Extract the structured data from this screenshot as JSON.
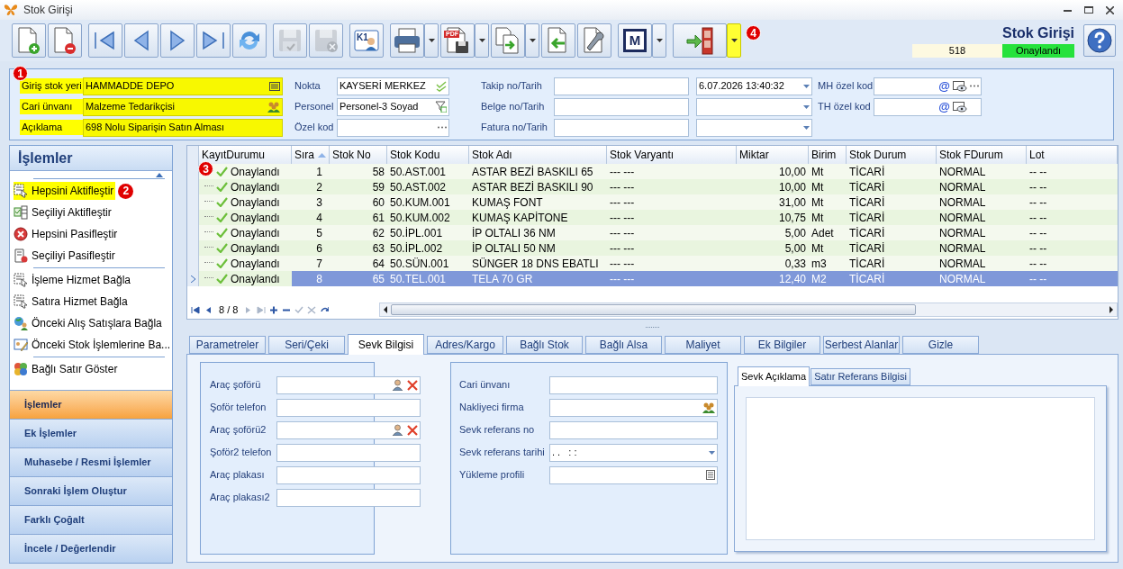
{
  "window": {
    "title": "Stok Girişi"
  },
  "toolbar": [
    {
      "kind": "button",
      "disabled": false
    },
    {
      "kind": "button",
      "disabled": false
    },
    {
      "kind": "button",
      "disabled": false
    },
    {
      "kind": "button",
      "disabled": false
    },
    {
      "kind": "button",
      "disabled": false
    },
    {
      "kind": "button",
      "disabled": false
    },
    {
      "kind": "button",
      "disabled": false
    },
    {
      "kind": "button",
      "disabled": true
    },
    {
      "kind": "button",
      "disabled": true
    },
    {
      "kind": "button",
      "disabled": false,
      "badge": "K1"
    },
    {
      "kind": "split",
      "disabled": false
    },
    {
      "kind": "split",
      "disabled": false,
      "badge": "PDF"
    },
    {
      "kind": "split",
      "disabled": false
    },
    {
      "kind": "button",
      "disabled": false
    },
    {
      "kind": "button",
      "disabled": false
    },
    {
      "kind": "split",
      "disabled": false,
      "badge": "M"
    },
    {
      "kind": "split",
      "disabled": false,
      "highlighted": true,
      "callout": "4"
    }
  ],
  "header": {
    "title": "Stok Girişi",
    "record_no": "518",
    "status": "Onaylandı"
  },
  "form": {
    "callout": "1",
    "main_fields": [
      {
        "label": "Giriş stok yeri",
        "value": "HAMMADDE DEPO",
        "highlighted": true
      },
      {
        "label": "Cari ünvanı",
        "value": "Malzeme Tedarikçisi",
        "highlighted": true
      },
      {
        "label": "Açıklama",
        "value": "698 Nolu Siparişin Satın Alması",
        "highlighted": true
      }
    ],
    "side_fields": [
      {
        "label": "Nokta",
        "value": "KAYSERİ MERKEZ"
      },
      {
        "label": "Personel",
        "value": "Personel-3 Soyad"
      },
      {
        "label": "Özel kod"
      }
    ],
    "tracking_fields": [
      {
        "label": "Takip no/Tarih",
        "date": "6.07.2026 13:40:32"
      },
      {
        "label": "Belge no/Tarih"
      },
      {
        "label": "Fatura no/Tarih"
      }
    ],
    "code_fields": [
      {
        "label": "MH özel kod",
        "symbol": "@"
      },
      {
        "label": "TH özel kod",
        "symbol": "@"
      }
    ]
  },
  "sidebar": {
    "title": "İşlemler",
    "sections": [
      {
        "items": [
          {
            "label": "Hepsini Aktifleştir",
            "highlighted": true,
            "callout": "2"
          },
          {
            "label": "Seçiliyi Aktifleştir",
            "highlighted": false
          },
          {
            "label": "Hepsini Pasifleştir",
            "highlighted": false
          },
          {
            "label": "Seçiliyi Pasifleştir",
            "highlighted": false
          }
        ]
      },
      {
        "items": [
          {
            "label": "İşleme Hizmet Bağla",
            "highlighted": false
          },
          {
            "label": "Satıra Hizmet Bağla",
            "highlighted": false
          },
          {
            "label": "Önceki Alış Satışlara Bağla",
            "highlighted": false
          },
          {
            "label": "Önceki Stok İşlemlerine Ba...",
            "highlighted": false
          }
        ]
      },
      {
        "items": [
          {
            "label": "Bağlı Satır Göster",
            "highlighted": false
          }
        ]
      }
    ],
    "nav": [
      {
        "label": "İşlemler",
        "selected": true
      },
      {
        "label": "Ek İşlemler",
        "selected": false
      },
      {
        "label": "Muhasebe / Resmi İşlemler",
        "selected": false
      },
      {
        "label": "Sonraki İşlem Oluştur",
        "selected": false
      },
      {
        "label": "Farklı Çoğalt",
        "selected": false
      },
      {
        "label": "İncele / Değerlendir",
        "selected": false
      }
    ]
  },
  "grid": {
    "callout": "3",
    "columns": [
      {
        "label": "KayıtDurumu",
        "sorted": false
      },
      {
        "label": "Sıra",
        "sorted": true
      },
      {
        "label": "Stok No",
        "sorted": false
      },
      {
        "label": "Stok Kodu",
        "sorted": false
      },
      {
        "label": "Stok Adı",
        "sorted": false
      },
      {
        "label": "Stok Varyantı",
        "sorted": false
      },
      {
        "label": "Miktar",
        "sorted": false
      },
      {
        "label": "Birim",
        "sorted": false
      },
      {
        "label": "Stok Durum",
        "sorted": false
      },
      {
        "label": "Stok FDurum",
        "sorted": false
      },
      {
        "label": "Lot",
        "sorted": false
      }
    ],
    "rows": [
      {
        "selected": false,
        "cells": [
          "Onaylandı",
          "1",
          "58",
          "50.AST.001",
          "ASTAR BEZİ BASKILI 65",
          "--- ---",
          "10,00",
          "Mt",
          "TİCARİ",
          "NORMAL",
          "-- --"
        ]
      },
      {
        "selected": false,
        "cells": [
          "Onaylandı",
          "2",
          "59",
          "50.AST.002",
          "ASTAR BEZİ BASKILI 90",
          "--- ---",
          "10,00",
          "Mt",
          "TİCARİ",
          "NORMAL",
          "-- --"
        ]
      },
      {
        "selected": false,
        "cells": [
          "Onaylandı",
          "3",
          "60",
          "50.KUM.001",
          "KUMAŞ FONT",
          "--- ---",
          "31,00",
          "Mt",
          "TİCARİ",
          "NORMAL",
          "-- --"
        ]
      },
      {
        "selected": false,
        "cells": [
          "Onaylandı",
          "4",
          "61",
          "50.KUM.002",
          "KUMAŞ KAPİTONE",
          "--- ---",
          "10,75",
          "Mt",
          "TİCARİ",
          "NORMAL",
          "-- --"
        ]
      },
      {
        "selected": false,
        "cells": [
          "Onaylandı",
          "5",
          "62",
          "50.İPL.001",
          "İP OLTALI 36 NM",
          "--- ---",
          "5,00",
          "Adet",
          "TİCARİ",
          "NORMAL",
          "-- --"
        ]
      },
      {
        "selected": false,
        "cells": [
          "Onaylandı",
          "6",
          "63",
          "50.İPL.002",
          "İP OLTALI 50 NM",
          "--- ---",
          "5,00",
          "Mt",
          "TİCARİ",
          "NORMAL",
          "-- --"
        ]
      },
      {
        "selected": false,
        "cells": [
          "Onaylandı",
          "7",
          "64",
          "50.SÜN.001",
          "SÜNGER 18 DNS EBATLI",
          "--- ---",
          "0,33",
          "m3",
          "TİCARİ",
          "NORMAL",
          "-- --"
        ]
      },
      {
        "selected": true,
        "cells": [
          "Onaylandı",
          "8",
          "65",
          "50.TEL.001",
          "TELA 70 GR",
          "--- ---",
          "12,40",
          "M2",
          "TİCARİ",
          "NORMAL",
          "-- --"
        ]
      }
    ],
    "record_position": "8 / 8"
  },
  "tabs": [
    {
      "label": "Parametreler",
      "selected": false
    },
    {
      "label": "Seri/Çeki",
      "selected": false
    },
    {
      "label": "Sevk Bilgisi",
      "selected": true
    },
    {
      "label": "Adres/Kargo",
      "selected": false
    },
    {
      "label": "Bağlı Stok",
      "selected": false
    },
    {
      "label": "Bağlı Alsa",
      "selected": false
    },
    {
      "label": "Maliyet",
      "selected": false
    },
    {
      "label": "Ek Bilgiler",
      "selected": false
    },
    {
      "label": "Serbest Alanlar",
      "selected": false
    },
    {
      "label": "Gizle",
      "selected": false
    }
  ],
  "driver_fields": [
    {
      "label": "Araç şoförü",
      "kind": "person"
    },
    {
      "label": "Şoför telefon",
      "kind": "text"
    },
    {
      "label": "Araç şoförü2",
      "kind": "person"
    },
    {
      "label": "Şoför2 telefon",
      "kind": "text"
    },
    {
      "label": "Araç plakası",
      "kind": "text"
    },
    {
      "label": "Araç plakası2",
      "kind": "text"
    }
  ],
  "shipping_fields": [
    {
      "label": "Cari ünvanı",
      "kind": "text"
    },
    {
      "label": "Nakliyeci firma",
      "kind": "lookup"
    },
    {
      "label": "Sevk referans no",
      "kind": "text"
    },
    {
      "label": "Sevk referans tarihi",
      "value": ". .   : :",
      "kind": "date"
    },
    {
      "label": "Yükleme profili",
      "kind": "list"
    }
  ],
  "sub_tabs": [
    {
      "label": "Sevk Açıklama",
      "selected": true
    },
    {
      "label": "Satır Referans Bilgisi",
      "selected": false
    }
  ]
}
